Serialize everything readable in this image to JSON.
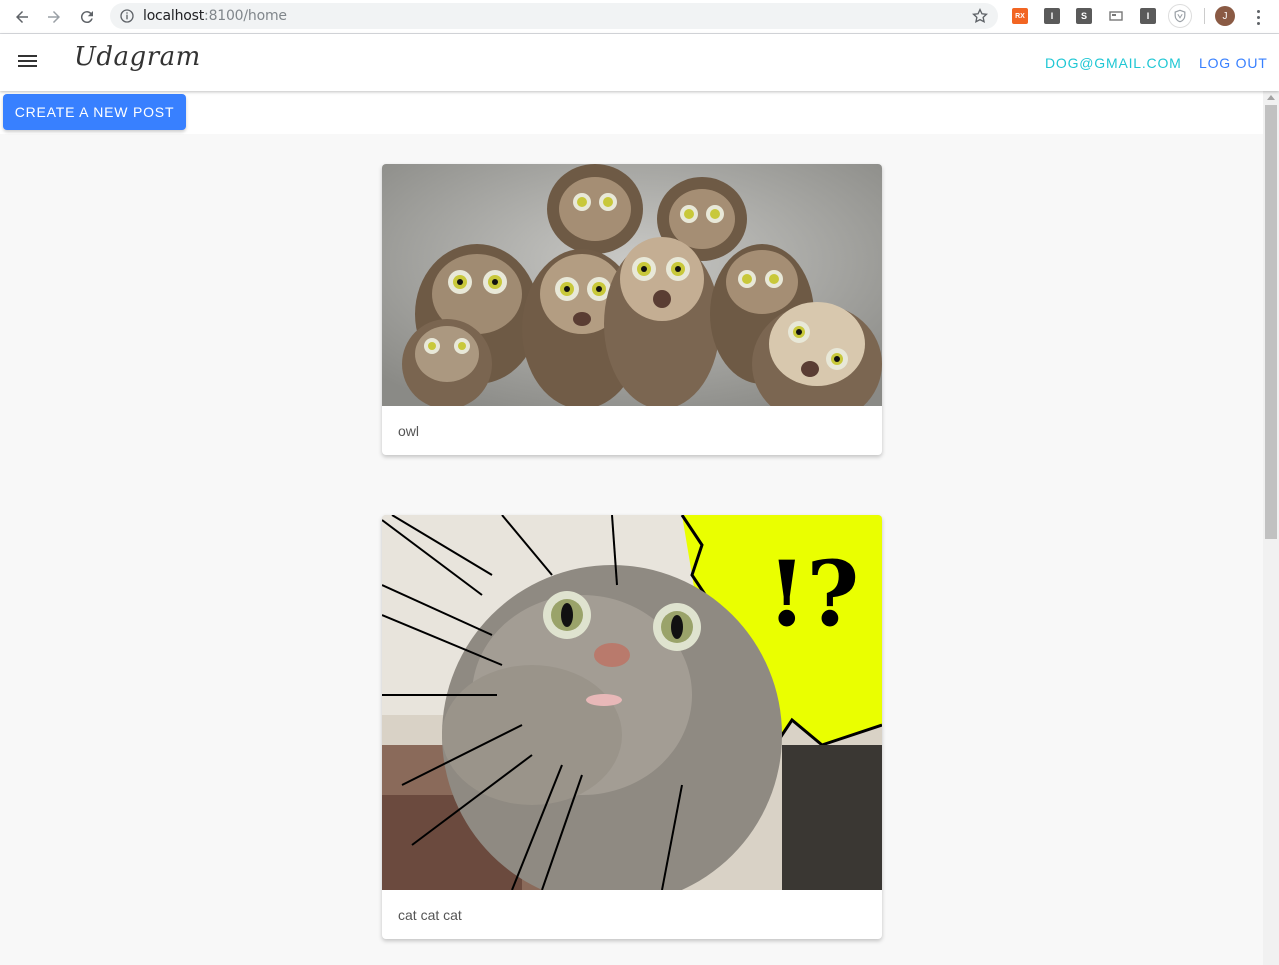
{
  "browser": {
    "url_host": "localhost",
    "url_rest": ":8100/home",
    "extensions": [
      {
        "name": "ext-orange-icon",
        "label": "RX",
        "color": "#f26522"
      },
      {
        "name": "ext-i-icon",
        "label": "I",
        "color": "#5a5a5a"
      },
      {
        "name": "ext-s-icon",
        "label": "S",
        "color": "#5a5a5a"
      },
      {
        "name": "ext-card-icon",
        "label": "",
        "color": "#9aa0a6"
      },
      {
        "name": "ext-i2-icon",
        "label": "I",
        "color": "#5a5a5a"
      }
    ],
    "avatar_initial": "J"
  },
  "header": {
    "brand": "Udagram",
    "email": "DOG@GMAIL.COM",
    "logout": "LOG OUT"
  },
  "toolbar": {
    "create_label": "CREATE A NEW POST"
  },
  "feed": {
    "posts": [
      {
        "caption": "owl",
        "image": "owl-photo"
      },
      {
        "caption": "cat cat cat",
        "image": "cat-photo"
      }
    ]
  },
  "colors": {
    "primary": "#3880ff",
    "secondary": "#1fc7d4"
  }
}
